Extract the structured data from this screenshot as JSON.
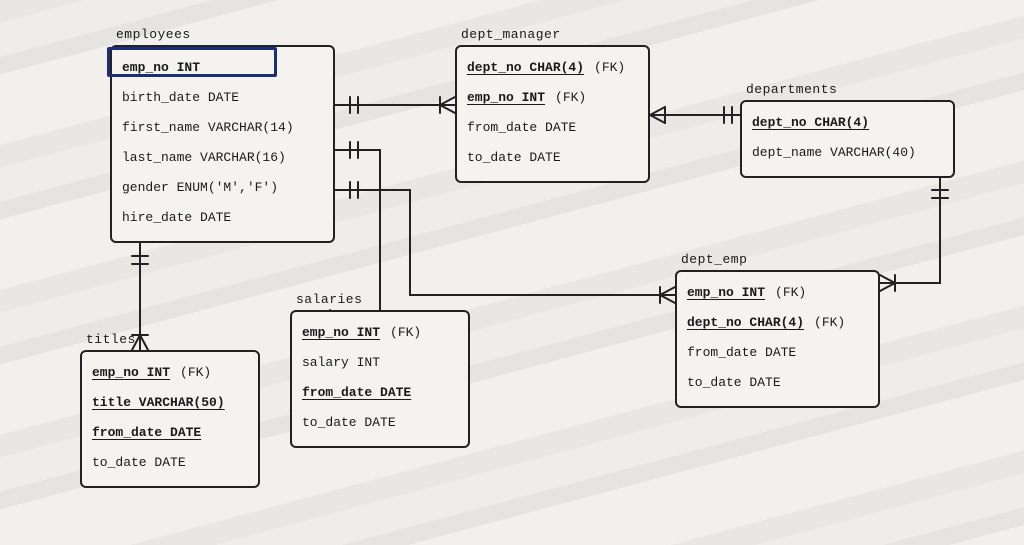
{
  "entities": {
    "employees": {
      "title": "employees",
      "columns": [
        {
          "name": "emp_no INT",
          "pk": true,
          "fk": false
        },
        {
          "name": "birth_date DATE",
          "pk": false,
          "fk": false
        },
        {
          "name": "first_name VARCHAR(14)",
          "pk": false,
          "fk": false
        },
        {
          "name": "last_name VARCHAR(16)",
          "pk": false,
          "fk": false
        },
        {
          "name": "gender ENUM('M','F')",
          "pk": false,
          "fk": false
        },
        {
          "name": "hire_date DATE",
          "pk": false,
          "fk": false
        }
      ]
    },
    "dept_manager": {
      "title": "dept_manager",
      "columns": [
        {
          "name": "dept_no CHAR(4)",
          "pk": true,
          "fk": true
        },
        {
          "name": "emp_no INT",
          "pk": true,
          "fk": true
        },
        {
          "name": "from_date DATE",
          "pk": false,
          "fk": false
        },
        {
          "name": "to_date DATE",
          "pk": false,
          "fk": false
        }
      ]
    },
    "departments": {
      "title": "departments",
      "columns": [
        {
          "name": "dept_no CHAR(4)",
          "pk": true,
          "fk": false
        },
        {
          "name": "dept_name VARCHAR(40)",
          "pk": false,
          "fk": false
        }
      ]
    },
    "dept_emp": {
      "title": "dept_emp",
      "columns": [
        {
          "name": "emp_no INT",
          "pk": true,
          "fk": true
        },
        {
          "name": "dept_no CHAR(4)",
          "pk": true,
          "fk": true
        },
        {
          "name": "from_date DATE",
          "pk": false,
          "fk": false
        },
        {
          "name": "to_date DATE",
          "pk": false,
          "fk": false
        }
      ]
    },
    "salaries": {
      "title": "salaries",
      "columns": [
        {
          "name": "emp_no INT",
          "pk": true,
          "fk": true
        },
        {
          "name": "salary INT",
          "pk": false,
          "fk": false
        },
        {
          "name": "from_date DATE",
          "pk": true,
          "fk": false
        },
        {
          "name": "to_date DATE",
          "pk": false,
          "fk": false
        }
      ]
    },
    "titles": {
      "title": "titles",
      "columns": [
        {
          "name": "emp_no INT",
          "pk": true,
          "fk": true
        },
        {
          "name": "title VARCHAR(50)",
          "pk": true,
          "fk": false
        },
        {
          "name": "from_date DATE",
          "pk": true,
          "fk": false
        },
        {
          "name": "to_date DATE",
          "pk": false,
          "fk": false
        }
      ]
    }
  },
  "fk_label": "(FK)"
}
